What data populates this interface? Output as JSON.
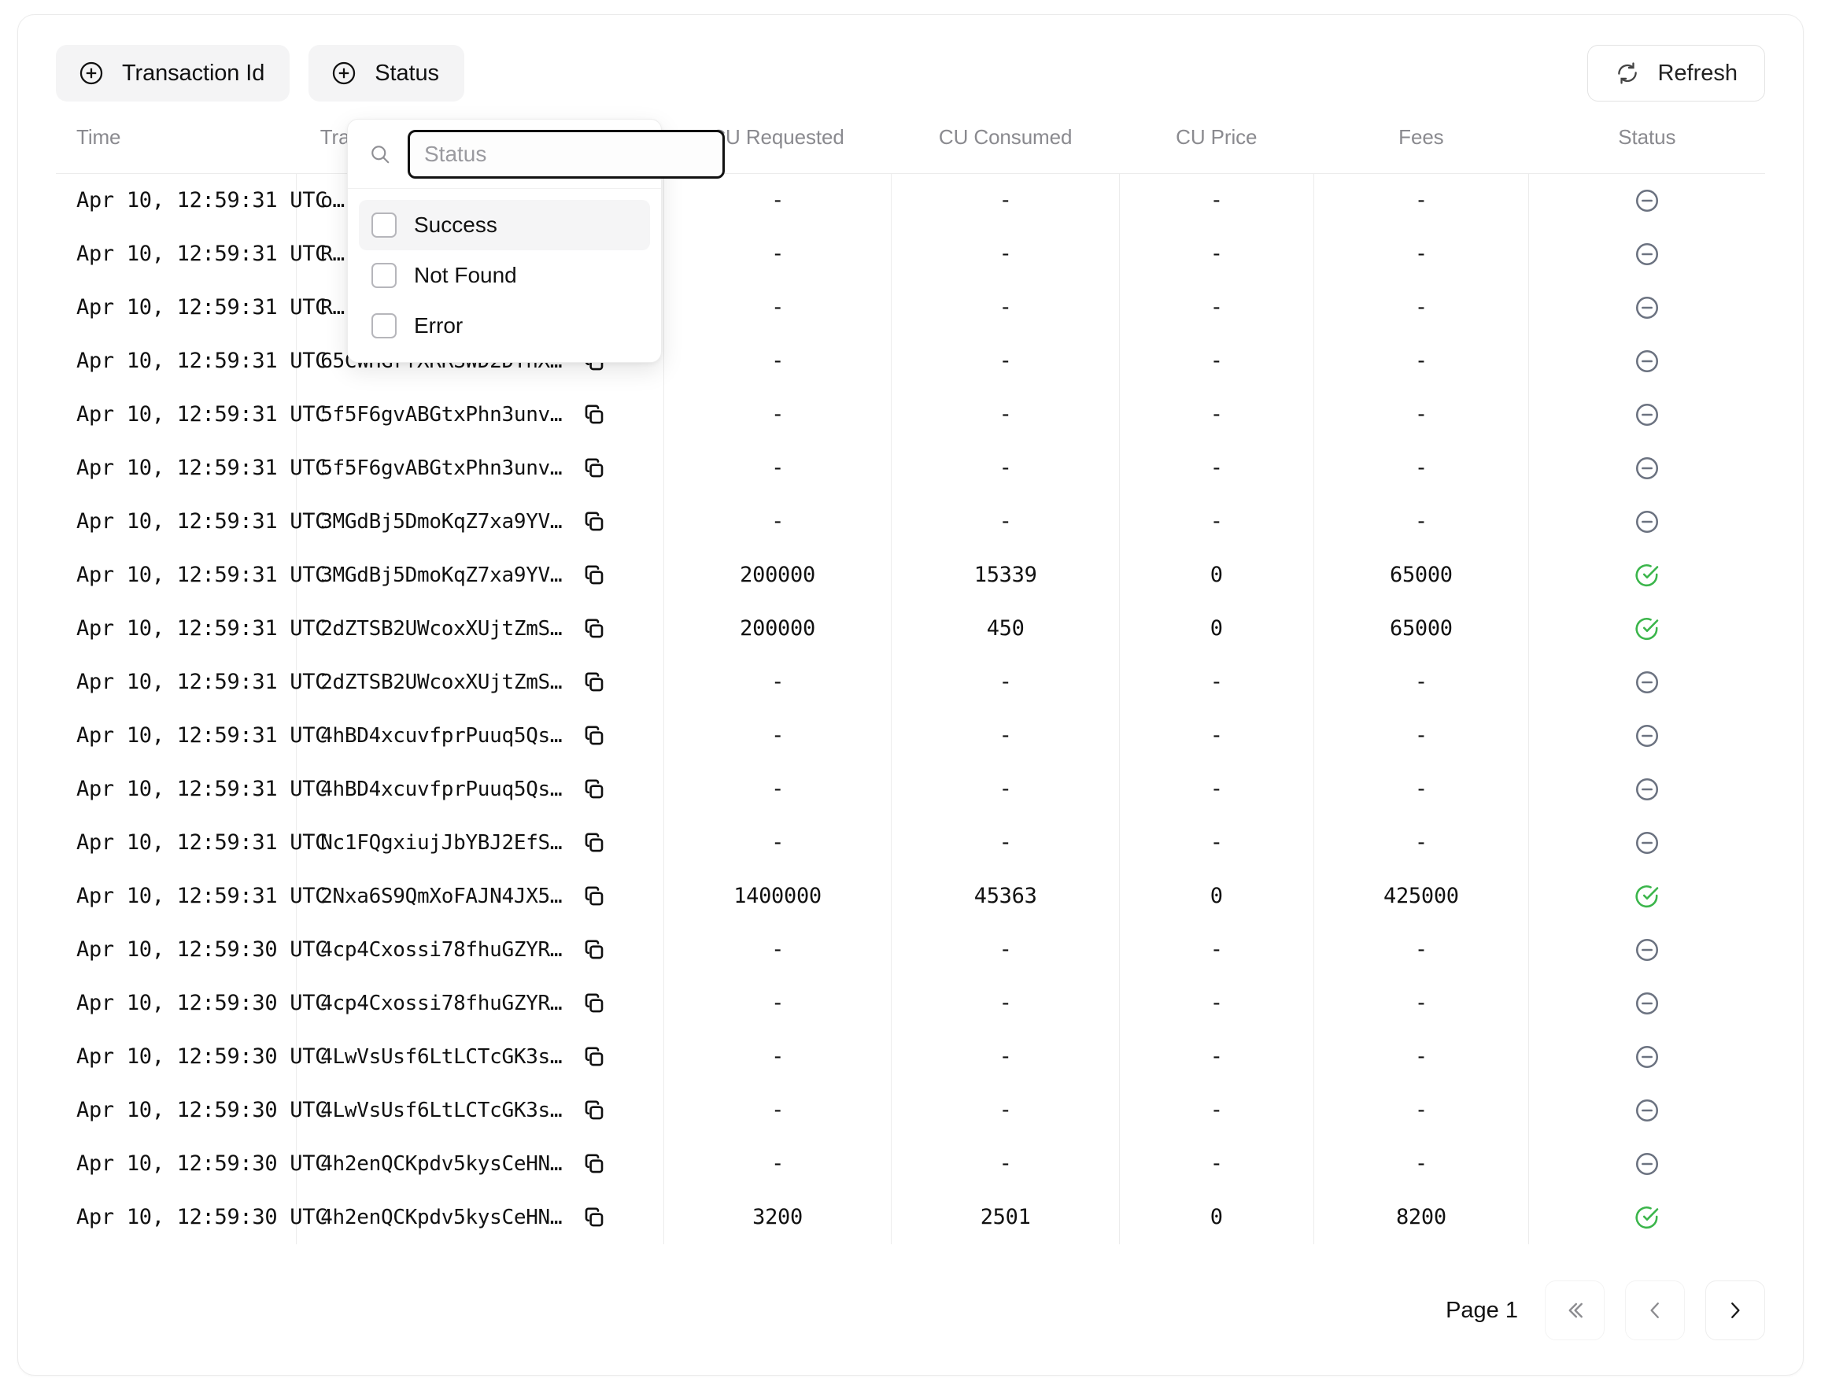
{
  "toolbar": {
    "filters": [
      {
        "label": "Transaction Id",
        "icon": "plus-circle-icon"
      },
      {
        "label": "Status",
        "icon": "plus-circle-icon"
      }
    ],
    "refresh_label": "Refresh",
    "refresh_icon": "refresh-icon"
  },
  "status_dropdown": {
    "open": true,
    "search_placeholder": "Status",
    "search_value": "",
    "search_icon": "search-icon",
    "options": [
      {
        "label": "Success",
        "checked": false,
        "highlighted": true
      },
      {
        "label": "Not Found",
        "checked": false,
        "highlighted": false
      },
      {
        "label": "Error",
        "checked": false,
        "highlighted": false
      }
    ]
  },
  "table": {
    "columns": [
      "Time",
      "Transaction Id",
      "CU Requested",
      "CU Consumed",
      "CU Price",
      "Fees",
      "Status"
    ],
    "rows": [
      {
        "time": "Apr 10, 12:59:31 UTC",
        "txid": "o…",
        "cu_requested": "-",
        "cu_consumed": "-",
        "cu_price": "-",
        "fees": "-",
        "status": "none"
      },
      {
        "time": "Apr 10, 12:59:31 UTC",
        "txid": "R…",
        "cu_requested": "-",
        "cu_consumed": "-",
        "cu_price": "-",
        "fees": "-",
        "status": "none"
      },
      {
        "time": "Apr 10, 12:59:31 UTC",
        "txid": "R…",
        "cu_requested": "-",
        "cu_consumed": "-",
        "cu_price": "-",
        "fees": "-",
        "status": "none"
      },
      {
        "time": "Apr 10, 12:59:31 UTC",
        "txid": "65CWHGrfXRRSWD2DYnX…",
        "cu_requested": "-",
        "cu_consumed": "-",
        "cu_price": "-",
        "fees": "-",
        "status": "none"
      },
      {
        "time": "Apr 10, 12:59:31 UTC",
        "txid": "5f5F6gvABGtxPhn3unv…",
        "cu_requested": "-",
        "cu_consumed": "-",
        "cu_price": "-",
        "fees": "-",
        "status": "none"
      },
      {
        "time": "Apr 10, 12:59:31 UTC",
        "txid": "5f5F6gvABGtxPhn3unv…",
        "cu_requested": "-",
        "cu_consumed": "-",
        "cu_price": "-",
        "fees": "-",
        "status": "none"
      },
      {
        "time": "Apr 10, 12:59:31 UTC",
        "txid": "3MGdBj5DmoKqZ7xa9YV…",
        "cu_requested": "-",
        "cu_consumed": "-",
        "cu_price": "-",
        "fees": "-",
        "status": "none"
      },
      {
        "time": "Apr 10, 12:59:31 UTC",
        "txid": "3MGdBj5DmoKqZ7xa9YV…",
        "cu_requested": "200000",
        "cu_consumed": "15339",
        "cu_price": "0",
        "fees": "65000",
        "status": "success"
      },
      {
        "time": "Apr 10, 12:59:31 UTC",
        "txid": "2dZTSB2UWcoxXUjtZmS…",
        "cu_requested": "200000",
        "cu_consumed": "450",
        "cu_price": "0",
        "fees": "65000",
        "status": "success"
      },
      {
        "time": "Apr 10, 12:59:31 UTC",
        "txid": "2dZTSB2UWcoxXUjtZmS…",
        "cu_requested": "-",
        "cu_consumed": "-",
        "cu_price": "-",
        "fees": "-",
        "status": "none"
      },
      {
        "time": "Apr 10, 12:59:31 UTC",
        "txid": "4hBD4xcuvfprPuuq5Qs…",
        "cu_requested": "-",
        "cu_consumed": "-",
        "cu_price": "-",
        "fees": "-",
        "status": "none"
      },
      {
        "time": "Apr 10, 12:59:31 UTC",
        "txid": "4hBD4xcuvfprPuuq5Qs…",
        "cu_requested": "-",
        "cu_consumed": "-",
        "cu_price": "-",
        "fees": "-",
        "status": "none"
      },
      {
        "time": "Apr 10, 12:59:31 UTC",
        "txid": "Nc1FQgxiujJbYBJ2EfS…",
        "cu_requested": "-",
        "cu_consumed": "-",
        "cu_price": "-",
        "fees": "-",
        "status": "none"
      },
      {
        "time": "Apr 10, 12:59:31 UTC",
        "txid": "2Nxa6S9QmXoFAJN4JX5…",
        "cu_requested": "1400000",
        "cu_consumed": "45363",
        "cu_price": "0",
        "fees": "425000",
        "status": "success"
      },
      {
        "time": "Apr 10, 12:59:30 UTC",
        "txid": "4cp4Cxossi78fhuGZYR…",
        "cu_requested": "-",
        "cu_consumed": "-",
        "cu_price": "-",
        "fees": "-",
        "status": "none"
      },
      {
        "time": "Apr 10, 12:59:30 UTC",
        "txid": "4cp4Cxossi78fhuGZYR…",
        "cu_requested": "-",
        "cu_consumed": "-",
        "cu_price": "-",
        "fees": "-",
        "status": "none"
      },
      {
        "time": "Apr 10, 12:59:30 UTC",
        "txid": "4LwVsUsf6LtLCTcGK3s…",
        "cu_requested": "-",
        "cu_consumed": "-",
        "cu_price": "-",
        "fees": "-",
        "status": "none"
      },
      {
        "time": "Apr 10, 12:59:30 UTC",
        "txid": "4LwVsUsf6LtLCTcGK3s…",
        "cu_requested": "-",
        "cu_consumed": "-",
        "cu_price": "-",
        "fees": "-",
        "status": "none"
      },
      {
        "time": "Apr 10, 12:59:30 UTC",
        "txid": "4h2enQCKpdv5kysCeHN…",
        "cu_requested": "-",
        "cu_consumed": "-",
        "cu_price": "-",
        "fees": "-",
        "status": "none"
      },
      {
        "time": "Apr 10, 12:59:30 UTC",
        "txid": "4h2enQCKpdv5kysCeHN…",
        "cu_requested": "3200",
        "cu_consumed": "2501",
        "cu_price": "0",
        "fees": "8200",
        "status": "success"
      }
    ],
    "copy_icon": "copy-icon",
    "status_icons": {
      "success": "check-circle-icon",
      "none": "minus-circle-icon"
    }
  },
  "pagination": {
    "page_label": "Page 1",
    "first_icon": "chevron-double-left-icon",
    "prev_icon": "chevron-left-icon",
    "next_icon": "chevron-right-icon",
    "first_disabled": true,
    "prev_disabled": true,
    "next_disabled": false
  },
  "colors": {
    "success_green": "#3ab54a",
    "muted_gray": "#6b7280",
    "header_text": "#8a8a8f",
    "chip_bg": "#f4f4f5",
    "border": "#ececec"
  }
}
